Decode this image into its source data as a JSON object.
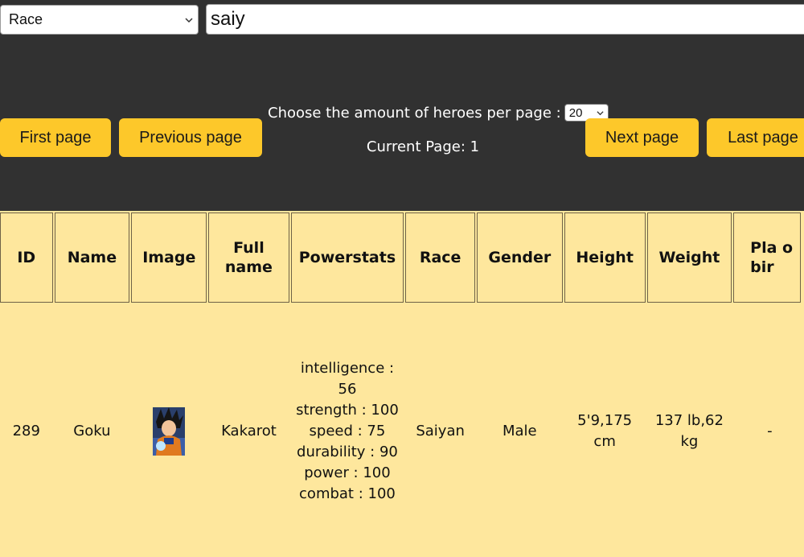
{
  "filter": {
    "field_label": "Race",
    "search_value": "saiy"
  },
  "pagination": {
    "first_label": "First page",
    "prev_label": "Previous page",
    "next_label": "Next page",
    "last_label": "Last page",
    "per_page_label": "Choose the amount of heroes per page :",
    "per_page_value": "20",
    "current_page_text": "Current Page: 1"
  },
  "colors": {
    "background": "#313131",
    "button": "#fdc82a",
    "table": "#fee79d"
  },
  "table": {
    "headers": [
      "ID",
      "Name",
      "Image",
      "Full name",
      "Powerstats",
      "Race",
      "Gender",
      "Height",
      "Weight",
      "Pla o bir"
    ],
    "rows": [
      {
        "id": "289",
        "name": "Goku",
        "image_icon": "goku-portrait-icon",
        "full_name": "Kakarot",
        "powerstats": {
          "intelligence": "intelligence : 56",
          "strength": "strength : 100",
          "speed": "speed : 75",
          "durability": "durability : 90",
          "power": "power : 100",
          "combat": "combat : 100"
        },
        "race": "Saiyan",
        "gender": "Male",
        "height": "5'9,175 cm",
        "weight": "137 lb,62 kg",
        "place_of_birth": "-"
      }
    ]
  }
}
